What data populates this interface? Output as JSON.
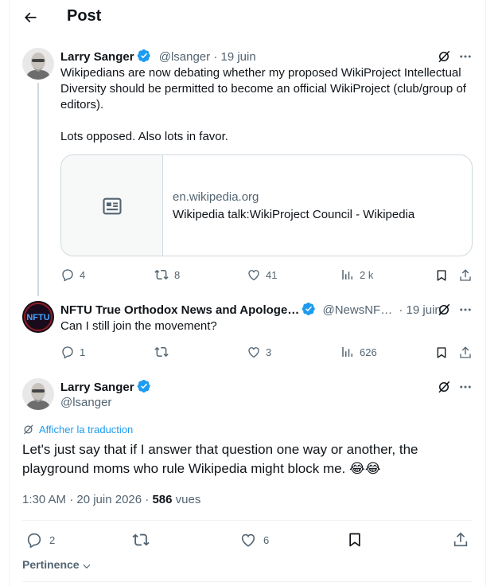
{
  "header": {
    "title": "Post",
    "back_icon": "arrow-left-icon"
  },
  "colors": {
    "accent": "#1d9bf0",
    "muted": "#536471",
    "border": "#cfd9de",
    "text": "#0f1419"
  },
  "tweet1": {
    "name": "Larry Sanger",
    "handle": "@lsanger",
    "date": "· 19 juin",
    "text": "Wikipedians are now debating whether my proposed WikiProject Intellectual Diversity should be permitted to become an official WikiProject (club/group of editors).\n\nLots opposed. Also lots in favor.",
    "card": {
      "domain": "en.wikipedia.org",
      "title": "Wikipedia talk:WikiProject Council - Wikipedia"
    },
    "stats": {
      "replies": "4",
      "reposts": "8",
      "likes": "41",
      "views": "2 k"
    }
  },
  "tweet2": {
    "name": "NFTU True Orthodox News and Apologe…",
    "handle": "@NewsNF…",
    "date": "· 19 juin",
    "avatar_text": "NFTU",
    "text": "Can I still join the movement?",
    "stats": {
      "replies": "1",
      "reposts": "",
      "likes": "3",
      "views": "626"
    }
  },
  "main_tweet": {
    "name": "Larry Sanger",
    "handle": "@lsanger",
    "translate_label": "Afficher la traduction",
    "text": "Let's just say that if I answer that question one way or another, the playground moms who rule Wikipedia might block me. 😂😂",
    "timestamp": "1:30 AM · 20 juin 2026 · ",
    "views_count": "586",
    "views_label": " vues",
    "stats": {
      "replies": "2",
      "reposts": "",
      "likes": "6"
    }
  },
  "sort": {
    "label": "Pertinence"
  }
}
